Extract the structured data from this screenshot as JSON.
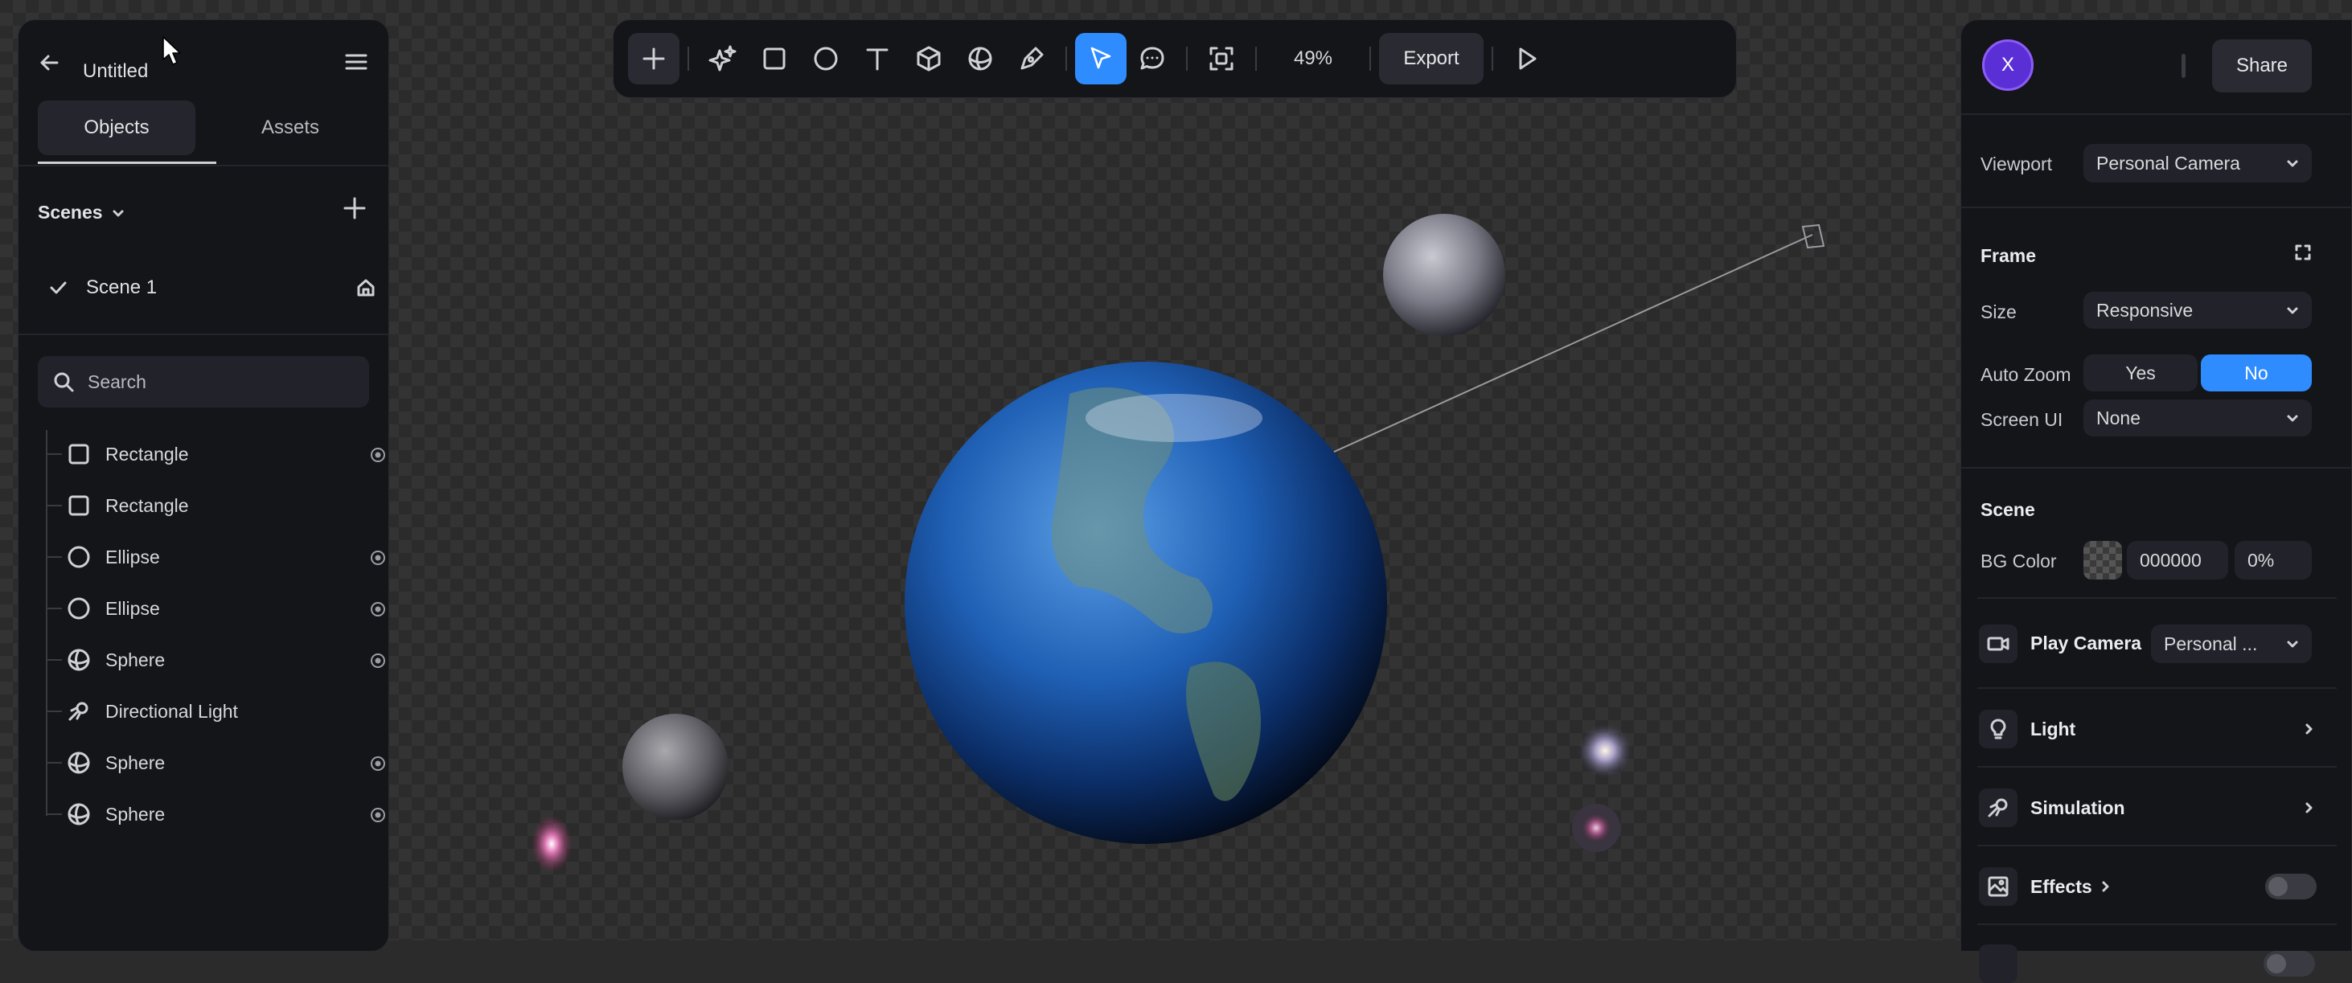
{
  "left_panel": {
    "title": "Untitled",
    "tabs": [
      {
        "label": "Objects"
      },
      {
        "label": "Assets"
      }
    ],
    "scenes_label": "Scenes",
    "scene_item": "Scene 1",
    "search_placeholder": "Search",
    "objects": [
      {
        "name": "Rectangle",
        "icon": "rectangle-icon",
        "visible_toggle": true
      },
      {
        "name": "Rectangle",
        "icon": "rectangle-icon",
        "visible_toggle": false
      },
      {
        "name": "Ellipse",
        "icon": "ellipse-icon",
        "visible_toggle": true
      },
      {
        "name": "Ellipse",
        "icon": "ellipse-icon",
        "visible_toggle": true
      },
      {
        "name": "Sphere",
        "icon": "sphere-icon",
        "visible_toggle": true
      },
      {
        "name": "Directional Light",
        "icon": "directional-light-icon",
        "visible_toggle": false
      },
      {
        "name": "Sphere",
        "icon": "sphere-icon",
        "visible_toggle": true
      },
      {
        "name": "Sphere",
        "icon": "sphere-icon",
        "visible_toggle": true
      }
    ]
  },
  "toolbar": {
    "zoom": "49%",
    "export_label": "Export",
    "active_tool": "select",
    "accent_color": "#2f8cff"
  },
  "right_panel": {
    "avatar_letter": "X",
    "share_label": "Share",
    "viewport_label": "Viewport",
    "viewport_value": "Personal Camera",
    "frame_header": "Frame",
    "size_label": "Size",
    "size_value": "Responsive",
    "auto_zoom_label": "Auto Zoom",
    "auto_zoom_yes": "Yes",
    "auto_zoom_no": "No",
    "screen_ui_label": "Screen UI",
    "screen_ui_value": "None",
    "scene_header": "Scene",
    "bg_color_label": "BG Color",
    "bg_color_hex": "000000",
    "bg_color_opacity": "0%",
    "play_camera_label": "Play Camera",
    "play_camera_value": "Personal ...",
    "light_label": "Light",
    "simulation_label": "Simulation",
    "effects_label": "Effects"
  }
}
